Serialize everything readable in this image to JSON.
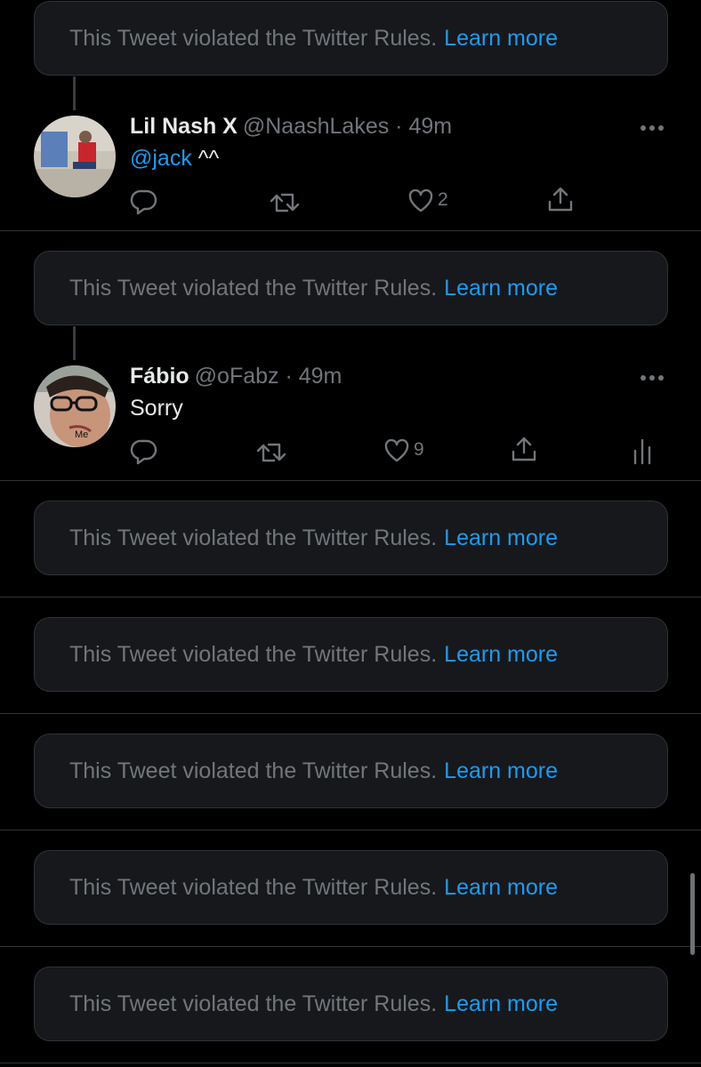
{
  "violation": {
    "text": "This Tweet violated the Twitter Rules.",
    "link": "Learn more"
  },
  "tweets": [
    {
      "name": "Lil Nash X",
      "meta": "@NaashLakes · 49m",
      "mention": "@jack",
      "text": " ^^",
      "likes": "2"
    },
    {
      "name": "Fábio",
      "meta": "@oFabz · 49m",
      "mention": "",
      "text": "Sorry",
      "likes": "9",
      "avatar_caption": "Me"
    }
  ],
  "icons": [
    "reply-icon",
    "retweet-icon",
    "like-icon",
    "share-icon",
    "analytics-icon",
    "more-icon"
  ],
  "colors": {
    "background": "#000000",
    "card": "#16181c",
    "link": "#1d9bf0",
    "muted": "#71767b"
  }
}
